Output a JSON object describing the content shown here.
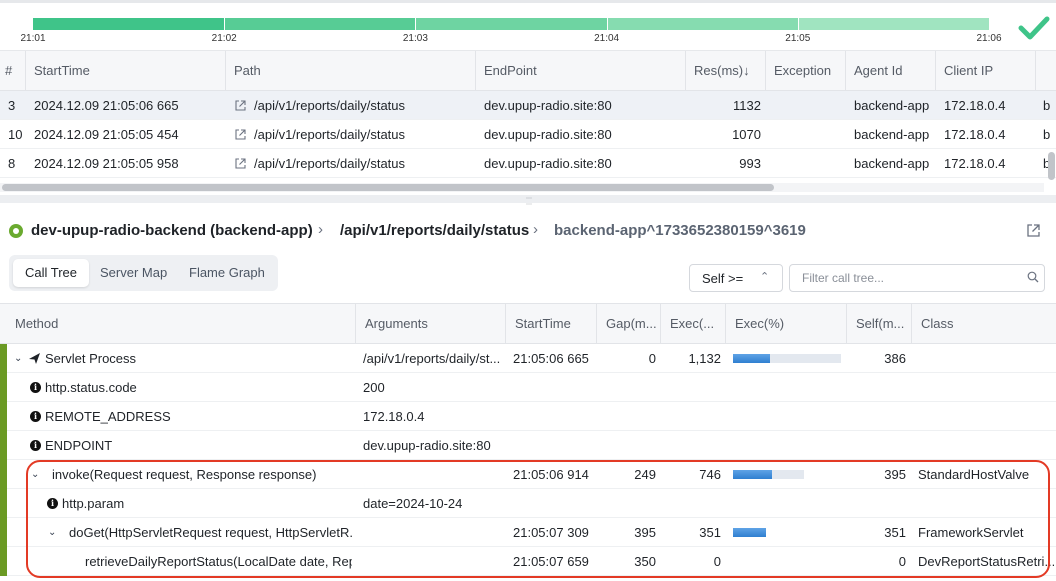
{
  "timeline": {
    "ticks": [
      "21:01",
      "21:02",
      "21:03",
      "21:04",
      "21:05",
      "21:06"
    ],
    "colors": [
      "#3fc489",
      "#57cc95",
      "#6ed4a2",
      "#86dcb0",
      "#a0e4c0"
    ],
    "status": "check-icon"
  },
  "requests": {
    "columns": [
      "#",
      "StartTime",
      "Path",
      "EndPoint",
      "Res(ms)",
      "Exception",
      "Agent Id",
      "Client IP"
    ],
    "sort_indicator": "↓",
    "rows": [
      {
        "num": "3",
        "start": "2024.12.09 21:05:06 665",
        "path": "/api/v1/reports/daily/status",
        "endpoint": "dev.upup-radio.site:80",
        "res": "1132",
        "agent": "backend-app",
        "ip": "172.18.0.4",
        "extra": "b"
      },
      {
        "num": "10",
        "start": "2024.12.09 21:05:05 454",
        "path": "/api/v1/reports/daily/status",
        "endpoint": "dev.upup-radio.site:80",
        "res": "1070",
        "agent": "backend-app",
        "ip": "172.18.0.4",
        "extra": "b"
      },
      {
        "num": "8",
        "start": "2024.12.09 21:05:05 958",
        "path": "/api/v1/reports/daily/status",
        "endpoint": "dev.upup-radio.site:80",
        "res": "993",
        "agent": "backend-app",
        "ip": "172.18.0.4",
        "extra": "b"
      }
    ]
  },
  "breadcrumb": {
    "app": "dev-upup-radio-backend (backend-app)",
    "path": "/api/v1/reports/daily/status",
    "transaction": "backend-app^1733652380159^3619"
  },
  "tabs": [
    "Call Tree",
    "Server Map",
    "Flame Graph"
  ],
  "self_filter": {
    "label": "Self >="
  },
  "filter_input": {
    "placeholder": "Filter call tree...",
    "value": ""
  },
  "calltree": {
    "columns": [
      "Method",
      "Arguments",
      "StartTime",
      "Gap(m...",
      "Exec(...",
      "Exec(%)",
      "Self(m...",
      "Class"
    ],
    "rows": [
      {
        "method": "Servlet Process",
        "args": "/api/v1/reports/daily/st...",
        "start": "21:05:06 665",
        "gap": "0",
        "exec": "1,132",
        "pct": 0.34,
        "self": "386",
        "cls": "",
        "icon": "servlet-icon",
        "caret": "expanded",
        "indent": 0
      },
      {
        "method": "http.status.code",
        "args": "200",
        "start": "",
        "gap": "",
        "exec": "",
        "pct": null,
        "self": "",
        "cls": "",
        "icon": "info-icon",
        "caret": "",
        "indent": 0
      },
      {
        "method": "REMOTE_ADDRESS",
        "args": "172.18.0.4",
        "start": "",
        "gap": "",
        "exec": "",
        "pct": null,
        "self": "",
        "cls": "",
        "icon": "info-icon",
        "caret": "",
        "indent": 0
      },
      {
        "method": "ENDPOINT",
        "args": "dev.upup-radio.site:80",
        "start": "",
        "gap": "",
        "exec": "",
        "pct": null,
        "self": "",
        "cls": "",
        "icon": "info-icon",
        "caret": "",
        "indent": 0
      },
      {
        "method": "invoke(Request request, Response response)",
        "args": "",
        "start": "21:05:06 914",
        "gap": "249",
        "exec": "746",
        "pct": 0.52,
        "self": "395",
        "cls": "StandardHostValve",
        "icon": "",
        "caret": "expanded",
        "indent": 1
      },
      {
        "method": "http.param",
        "args": "date=2024-10-24",
        "start": "",
        "gap": "",
        "exec": "",
        "pct": null,
        "self": "",
        "cls": "",
        "icon": "info-icon",
        "caret": "",
        "indent": 1
      },
      {
        "method": "doGet(HttpServletRequest request, HttpServletR...",
        "args": "",
        "start": "21:05:07 309",
        "gap": "395",
        "exec": "351",
        "pct": 1.0,
        "self": "351",
        "cls": "FrameworkServlet",
        "icon": "",
        "caret": "expanded",
        "indent": 2
      },
      {
        "method": "retrieveDailyReportStatus(LocalDate date, Repor...",
        "args": "",
        "start": "21:05:07 659",
        "gap": "350",
        "exec": "0",
        "pct": null,
        "self": "0",
        "cls": "DevReportStatusRetri...",
        "icon": "",
        "caret": "",
        "indent": 2
      }
    ]
  },
  "highlight_color": "#e33a25"
}
